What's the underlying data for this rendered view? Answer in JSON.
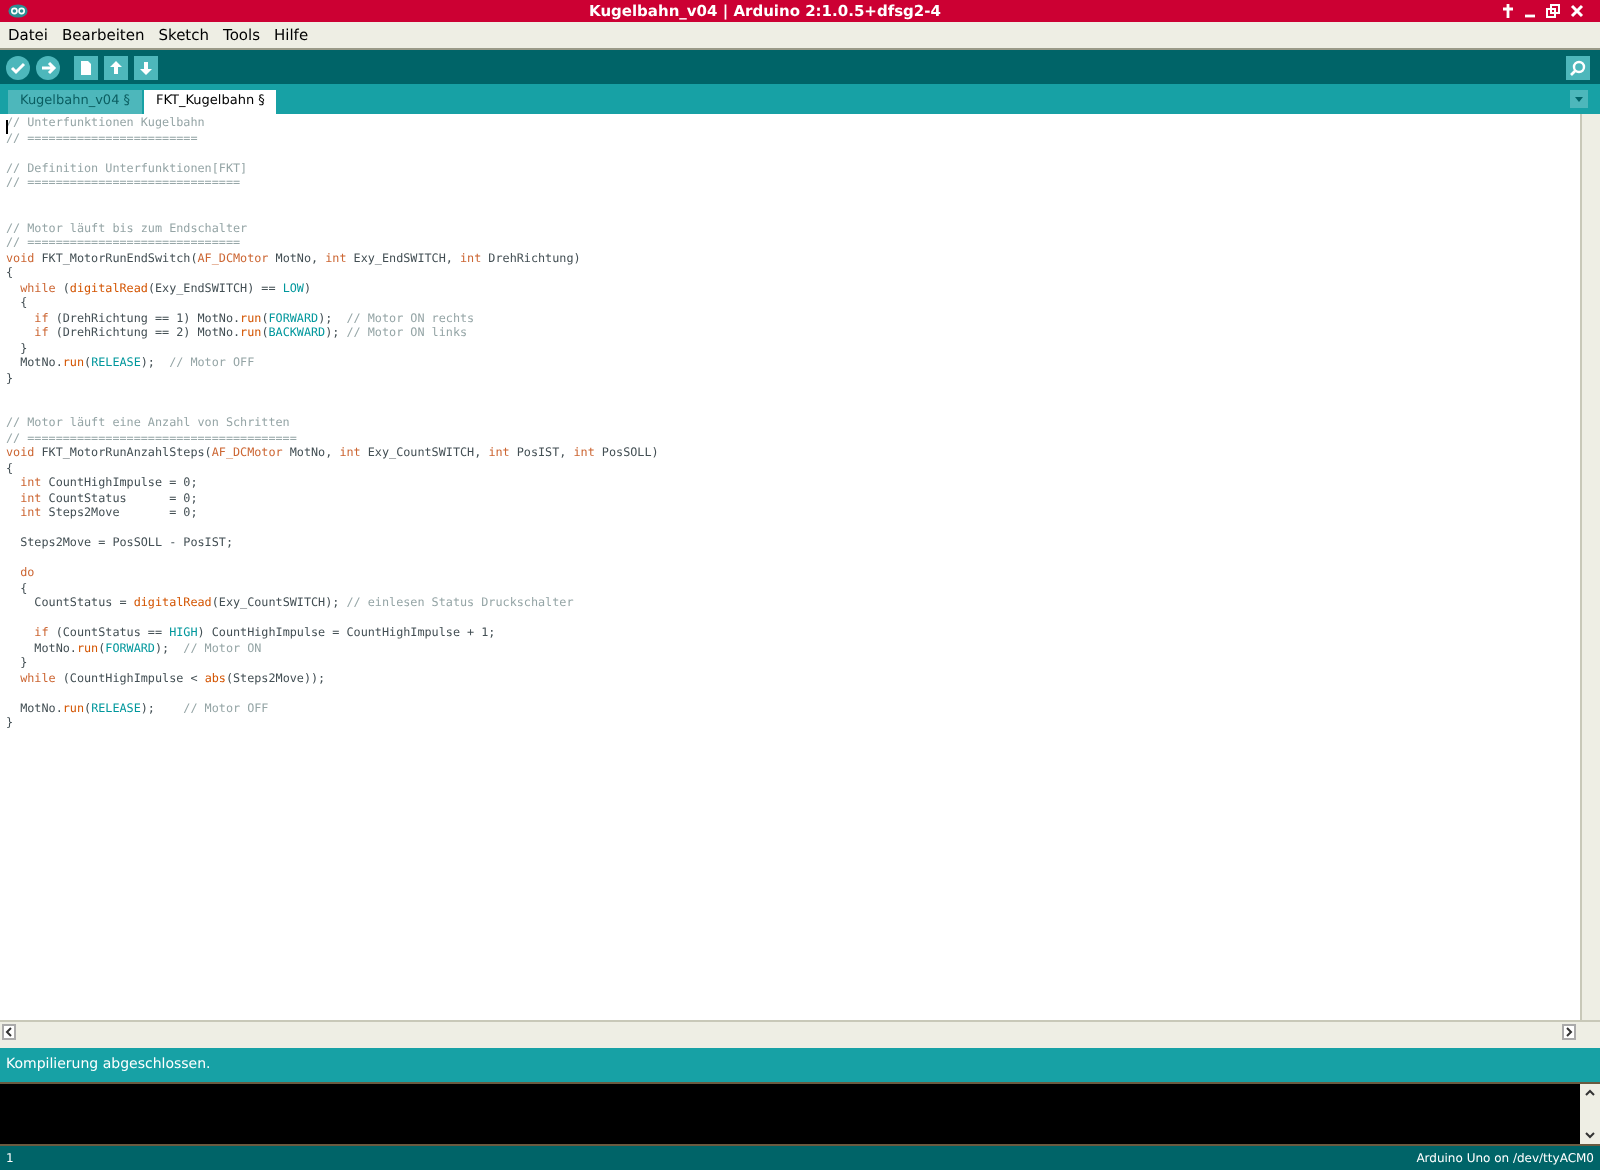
{
  "window": {
    "title": "Kugelbahn_v04 | Arduino 2:1.0.5+dfsg2-4"
  },
  "menu": [
    "Datei",
    "Bearbeiten",
    "Sketch",
    "Tools",
    "Hilfe"
  ],
  "tabs": [
    {
      "label": "Kugelbahn_v04 §",
      "selected": false
    },
    {
      "label": "FKT_Kugelbahn §",
      "selected": true
    }
  ],
  "editor": {
    "lines": [
      {
        "kind": "code",
        "tokens": [
          {
            "kind": "comment",
            "text": "// Unterfunktionen Kugelbahn"
          }
        ]
      },
      {
        "kind": "code",
        "tokens": [
          {
            "kind": "comment",
            "text": "// ========================"
          }
        ]
      },
      {
        "kind": "blank"
      },
      {
        "kind": "code",
        "tokens": [
          {
            "kind": "comment",
            "text": "// Definition Unterfunktionen[FKT]"
          }
        ]
      },
      {
        "kind": "code",
        "tokens": [
          {
            "kind": "comment",
            "text": "// =============================="
          }
        ]
      },
      {
        "kind": "blank"
      },
      {
        "kind": "blank"
      },
      {
        "kind": "code",
        "tokens": [
          {
            "kind": "comment",
            "text": "// Motor läuft bis zum Endschalter"
          }
        ]
      },
      {
        "kind": "code",
        "tokens": [
          {
            "kind": "comment",
            "text": "// =============================="
          }
        ]
      },
      {
        "kind": "code",
        "tokens": [
          {
            "kind": "keyword",
            "text": "void"
          },
          {
            "kind": "plain",
            "text": " FKT_MotorRunEndSwitch("
          },
          {
            "kind": "keyword",
            "text": "AF_DCMotor"
          },
          {
            "kind": "plain",
            "text": " MotNo, "
          },
          {
            "kind": "keyword",
            "text": "int"
          },
          {
            "kind": "plain",
            "text": " Exy_EndSWITCH, "
          },
          {
            "kind": "keyword",
            "text": "int"
          },
          {
            "kind": "plain",
            "text": " DrehRichtung)"
          }
        ]
      },
      {
        "kind": "code",
        "tokens": [
          {
            "kind": "plain",
            "text": "{"
          }
        ]
      },
      {
        "kind": "code",
        "tokens": [
          {
            "kind": "keyword",
            "text": "  while"
          },
          {
            "kind": "plain",
            "text": " ("
          },
          {
            "kind": "function",
            "text": "digitalRead"
          },
          {
            "kind": "plain",
            "text": "(Exy_EndSWITCH) == "
          },
          {
            "kind": "constant",
            "text": "LOW"
          },
          {
            "kind": "plain",
            "text": ")"
          }
        ]
      },
      {
        "kind": "code",
        "tokens": [
          {
            "kind": "plain",
            "text": "  {"
          }
        ]
      },
      {
        "kind": "code",
        "tokens": [
          {
            "kind": "keyword",
            "text": "    if"
          },
          {
            "kind": "plain",
            "text": " (DrehRichtung == 1) MotNo."
          },
          {
            "kind": "function",
            "text": "run"
          },
          {
            "kind": "plain",
            "text": "("
          },
          {
            "kind": "constant",
            "text": "FORWARD"
          },
          {
            "kind": "plain",
            "text": ");  "
          },
          {
            "kind": "comment",
            "text": "// Motor ON rechts"
          }
        ]
      },
      {
        "kind": "code",
        "tokens": [
          {
            "kind": "keyword",
            "text": "    if"
          },
          {
            "kind": "plain",
            "text": " (DrehRichtung == 2) MotNo."
          },
          {
            "kind": "function",
            "text": "run"
          },
          {
            "kind": "plain",
            "text": "("
          },
          {
            "kind": "constant",
            "text": "BACKWARD"
          },
          {
            "kind": "plain",
            "text": "); "
          },
          {
            "kind": "comment",
            "text": "// Motor ON links"
          }
        ]
      },
      {
        "kind": "code",
        "tokens": [
          {
            "kind": "plain",
            "text": "  }"
          }
        ]
      },
      {
        "kind": "code",
        "tokens": [
          {
            "kind": "plain",
            "text": "  MotNo."
          },
          {
            "kind": "function",
            "text": "run"
          },
          {
            "kind": "plain",
            "text": "("
          },
          {
            "kind": "constant",
            "text": "RELEASE"
          },
          {
            "kind": "plain",
            "text": ");  "
          },
          {
            "kind": "comment",
            "text": "// Motor OFF"
          }
        ]
      },
      {
        "kind": "code",
        "tokens": [
          {
            "kind": "plain",
            "text": "}"
          }
        ]
      },
      {
        "kind": "blank"
      },
      {
        "kind": "blank"
      },
      {
        "kind": "code",
        "tokens": [
          {
            "kind": "comment",
            "text": "// Motor läuft eine Anzahl von Schritten"
          }
        ]
      },
      {
        "kind": "code",
        "tokens": [
          {
            "kind": "comment",
            "text": "// ======================================"
          }
        ]
      },
      {
        "kind": "code",
        "tokens": [
          {
            "kind": "keyword",
            "text": "void"
          },
          {
            "kind": "plain",
            "text": " FKT_MotorRunAnzahlSteps("
          },
          {
            "kind": "keyword",
            "text": "AF_DCMotor"
          },
          {
            "kind": "plain",
            "text": " MotNo, "
          },
          {
            "kind": "keyword",
            "text": "int"
          },
          {
            "kind": "plain",
            "text": " Exy_CountSWITCH, "
          },
          {
            "kind": "keyword",
            "text": "int"
          },
          {
            "kind": "plain",
            "text": " PosIST, "
          },
          {
            "kind": "keyword",
            "text": "int"
          },
          {
            "kind": "plain",
            "text": " PosSOLL)"
          }
        ]
      },
      {
        "kind": "code",
        "tokens": [
          {
            "kind": "plain",
            "text": "{"
          }
        ]
      },
      {
        "kind": "code",
        "tokens": [
          {
            "kind": "keyword",
            "text": "  int"
          },
          {
            "kind": "plain",
            "text": " CountHighImpulse = 0;"
          }
        ]
      },
      {
        "kind": "code",
        "tokens": [
          {
            "kind": "keyword",
            "text": "  int"
          },
          {
            "kind": "plain",
            "text": " CountStatus      = 0;"
          }
        ]
      },
      {
        "kind": "code",
        "tokens": [
          {
            "kind": "keyword",
            "text": "  int"
          },
          {
            "kind": "plain",
            "text": " Steps2Move       = 0;"
          }
        ]
      },
      {
        "kind": "blank"
      },
      {
        "kind": "code",
        "tokens": [
          {
            "kind": "plain",
            "text": "  Steps2Move = PosSOLL - PosIST;"
          }
        ]
      },
      {
        "kind": "blank"
      },
      {
        "kind": "code",
        "tokens": [
          {
            "kind": "keyword",
            "text": "  do"
          }
        ]
      },
      {
        "kind": "code",
        "tokens": [
          {
            "kind": "plain",
            "text": "  {"
          }
        ]
      },
      {
        "kind": "code",
        "tokens": [
          {
            "kind": "plain",
            "text": "    CountStatus = "
          },
          {
            "kind": "function",
            "text": "digitalRead"
          },
          {
            "kind": "plain",
            "text": "(Exy_CountSWITCH); "
          },
          {
            "kind": "comment",
            "text": "// einlesen Status Druckschalter"
          }
        ]
      },
      {
        "kind": "blank"
      },
      {
        "kind": "code",
        "tokens": [
          {
            "kind": "keyword",
            "text": "    if"
          },
          {
            "kind": "plain",
            "text": " (CountStatus == "
          },
          {
            "kind": "constant",
            "text": "HIGH"
          },
          {
            "kind": "plain",
            "text": ") CountHighImpulse = CountHighImpulse + 1;"
          }
        ]
      },
      {
        "kind": "code",
        "tokens": [
          {
            "kind": "plain",
            "text": "    MotNo."
          },
          {
            "kind": "function",
            "text": "run"
          },
          {
            "kind": "plain",
            "text": "("
          },
          {
            "kind": "constant",
            "text": "FORWARD"
          },
          {
            "kind": "plain",
            "text": ");  "
          },
          {
            "kind": "comment",
            "text": "// Motor ON"
          }
        ]
      },
      {
        "kind": "code",
        "tokens": [
          {
            "kind": "plain",
            "text": "  }"
          }
        ]
      },
      {
        "kind": "code",
        "tokens": [
          {
            "kind": "keyword",
            "text": "  while"
          },
          {
            "kind": "plain",
            "text": " (CountHighImpulse < "
          },
          {
            "kind": "function",
            "text": "abs"
          },
          {
            "kind": "plain",
            "text": "(Steps2Move));"
          }
        ]
      },
      {
        "kind": "blank"
      },
      {
        "kind": "code",
        "tokens": [
          {
            "kind": "plain",
            "text": "  MotNo."
          },
          {
            "kind": "function",
            "text": "run"
          },
          {
            "kind": "plain",
            "text": "("
          },
          {
            "kind": "constant",
            "text": "RELEASE"
          },
          {
            "kind": "plain",
            "text": ");    "
          },
          {
            "kind": "comment",
            "text": "// Motor OFF"
          }
        ]
      },
      {
        "kind": "code",
        "tokens": [
          {
            "kind": "plain",
            "text": "}"
          }
        ]
      }
    ]
  },
  "status": "Kompilierung abgeschlossen.",
  "footer": {
    "line": "1",
    "board": "Arduino Uno on /dev/ttyACM0"
  }
}
